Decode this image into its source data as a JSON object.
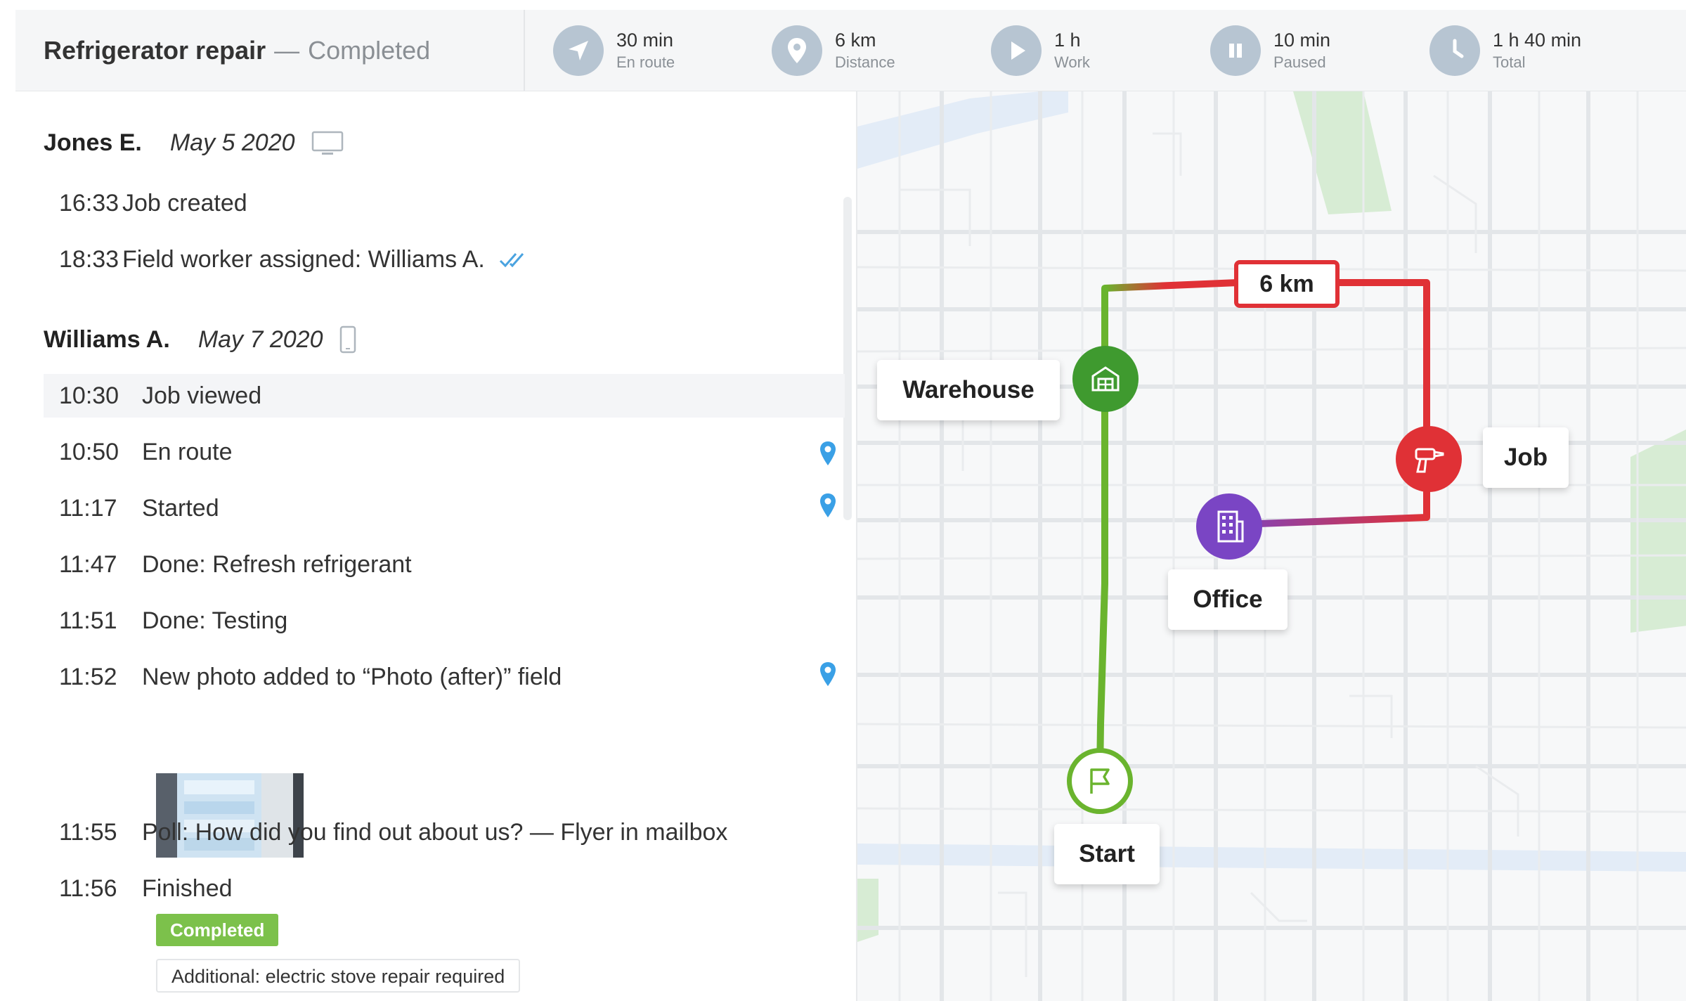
{
  "header": {
    "title": "Refrigerator repair",
    "separator": "—",
    "status": "Completed",
    "stats": [
      {
        "icon": "navigation-arrow-icon",
        "value": "30 min",
        "label": "En route"
      },
      {
        "icon": "location-pin-icon",
        "value": "6 km",
        "label": "Distance"
      },
      {
        "icon": "play-icon",
        "value": "1 h",
        "label": "Work"
      },
      {
        "icon": "pause-icon",
        "value": "10 min",
        "label": "Paused"
      },
      {
        "icon": "clock-icon",
        "value": "1 h 40 min",
        "label": "Total"
      }
    ]
  },
  "log": {
    "groups": [
      {
        "user": "Jones E.",
        "date": "May 5 2020",
        "device_icon": "desktop-icon",
        "events": [
          {
            "time": "16:33",
            "text": "Job created"
          },
          {
            "time": "18:33",
            "text": "Field worker assigned: Williams A.",
            "icon": "double-check-icon"
          }
        ]
      },
      {
        "user": "Williams A.",
        "date": "May 7 2020",
        "device_icon": "mobile-icon",
        "events": [
          {
            "time": "10:30",
            "text": "Job viewed"
          },
          {
            "time": "10:50",
            "text": "En route",
            "icon": "location-pin-icon"
          },
          {
            "time": "11:17",
            "text": "Started",
            "icon": "location-pin-icon"
          },
          {
            "time": "11:47",
            "text": "Done: Refresh refrigerant"
          },
          {
            "time": "11:51",
            "text": "Done: Testing"
          },
          {
            "time": "11:52",
            "text": "New photo added to “Photo (after)” field",
            "icon": "location-pin-icon"
          },
          {
            "time": "11:55",
            "text": "Poll: How did you find out about us? — Flyer in mailbox"
          },
          {
            "time": "11:56",
            "text": "Finished"
          }
        ],
        "badge": "Completed",
        "note": "Additional: electric stove repair required"
      }
    ]
  },
  "map": {
    "distance_label": "6 km",
    "places": [
      {
        "name": "Warehouse",
        "icon": "warehouse-icon",
        "color": "#3f9a2f"
      },
      {
        "name": "Job",
        "icon": "drill-icon",
        "color": "#e03136"
      },
      {
        "name": "Office",
        "icon": "office-building-icon",
        "color": "#7a45c4"
      },
      {
        "name": "Start",
        "icon": "flag-icon",
        "color": "#6ab42e"
      }
    ],
    "colors": {
      "route_green": "#6ab42e",
      "route_red": "#e03136",
      "route_purple": "#7a45c4",
      "park": "#d7ecd4",
      "water": "#e3ecf7"
    }
  }
}
